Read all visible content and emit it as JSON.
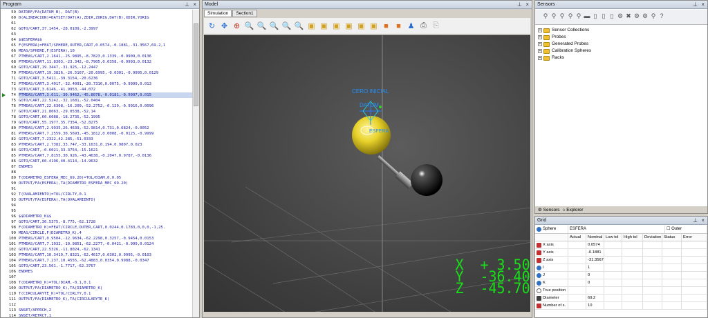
{
  "program": {
    "title": "Program",
    "lines": [
      {
        "n": "59",
        "t": "DATDEF/FA(DATUM_B), DAT(B)"
      },
      {
        "n": "60",
        "t": "D(ALINEACION)=DATSET/DAT(A),ZDIR,ZORIG,DAT(B),XDIR,YORIG"
      },
      {
        "n": "61",
        "t": ""
      },
      {
        "n": "62",
        "t": "GOTO/CART,37.1454,-28.0109,-2.3997"
      },
      {
        "n": "63",
        "t": ""
      },
      {
        "n": "64",
        "t": "$$ESFERA$$"
      },
      {
        "n": "65",
        "t": "F(ESFERA)=FEAT/SPHERE,OUTER,CART,0.0574,-0.1881,-31.3567,69.2,1"
      },
      {
        "n": "66",
        "t": "MEAS/SPHERE,F(ESFERA),10"
      },
      {
        "n": "67",
        "t": "PTMEAS/CART,2.1641,-25.9895,-8.7823,0.1339,-0.9909,0.0136"
      },
      {
        "n": "68",
        "t": "PTMEAS/CART,11.8303,-23.342,-8.7905,0.0358,-0.9993,0.0132"
      },
      {
        "n": "69",
        "t": "GOTO/CART,19.3447,-31.925,-12.2447"
      },
      {
        "n": "70",
        "t": "PTMEAS/CART,19.3826,-26.5167,-20.6995,-0.0301,-0.9995,0.0129"
      },
      {
        "n": "71",
        "t": "GOTO/CART,3.5411,-39.3154,-20.6236"
      },
      {
        "n": "72",
        "t": "PTMEAS/CART,3.4917,-32.4091,-20.7316,0.0075,-0.9999,0.013"
      },
      {
        "n": "73",
        "t": "GOTO/CART,3.6146,-41.9953,-44.072"
      },
      {
        "n": "74",
        "t": "PTMEAS/CART,3.611,-30.9462,-45.8078,-0.0181,-0.9997,0.015"
      },
      {
        "n": "75",
        "t": "GOTO/CART,22.5242,-32.1681,-52.0404"
      },
      {
        "n": "76",
        "t": "PTMEAS/CART,22.6308,-16.209,-52.2752,-0.129,-0.9916,0.0096"
      },
      {
        "n": "77",
        "t": "GOTO/CART,21.8063,-29.0538,-52.14"
      },
      {
        "n": "78",
        "t": "GOTO/CART,60.6088,-18.2735,-52.1995"
      },
      {
        "n": "79",
        "t": "GOTO/CART,55.1977,35.7354,-52.8275"
      },
      {
        "n": "80",
        "t": "PTMEAS/CART,2.9935,26.4639,-52.9814,0.731,0.6824,-0.0052"
      },
      {
        "n": "81",
        "t": "PTMEAS/CART,7.2559,30.5693,-45.1812,0.0008,-0.0125,-0.9999"
      },
      {
        "n": "82",
        "t": "GOTO/CART,7.2322,42.285,-51.0333"
      },
      {
        "n": "83",
        "t": "PTMEAS/CART,2.7382,33.747,-33.1631,0.194,0.9807,0.023"
      },
      {
        "n": "84",
        "t": "GOTO/CART,-0.6021,33.3754,-15.1621"
      },
      {
        "n": "85",
        "t": "PTMEAS/CART,7.8155,30.926,-43.4638,-0.2047,0.9787,-0.0136"
      },
      {
        "n": "86",
        "t": "GOTO/CART,60.4196,40.4114,-14.9632"
      },
      {
        "n": "87",
        "t": "ENDMES"
      },
      {
        "n": "88",
        "t": ""
      },
      {
        "n": "89",
        "t": "T(DIAMETRO_ESFERA_MEC_69.20)=TOL/DIAM,0,0.05"
      },
      {
        "n": "90",
        "t": "OUTPUT/FA(ESFERA),TA(DIAMETRO_ESFERA_MEC_69.20)"
      },
      {
        "n": "91",
        "t": ""
      },
      {
        "n": "92",
        "t": "T(OVALAMIENTO)=TOL/CIRLTY,0.1"
      },
      {
        "n": "93",
        "t": "OUTPUT/FA(ESFERA),TA(OVALAMIENTO)"
      },
      {
        "n": "94",
        "t": ""
      },
      {
        "n": "95",
        "t": ""
      },
      {
        "n": "96",
        "t": "$$DIAMETRO_K$$"
      },
      {
        "n": "97",
        "t": "GOTO/CART,36.5375,-8.775,-62.1728"
      },
      {
        "n": "98",
        "t": "F(DIAMETRO_K)=FEAT/CIRCLE,OUTER,CART,0.0244,0.1783,0,0,0,-1,25."
      },
      {
        "n": "99",
        "t": "MEAS/CIRCLE,F(DIAMETRO_K),4"
      },
      {
        "n": "100",
        "t": "PTMEAS/CART,0.9504,-12.9634,-62.2298,0.3257,-0.9454,0.0153"
      },
      {
        "n": "101",
        "t": "PTMEAS/CART,7.1932,-10.9851,-62.2277,-0.0421,-0.999,0.0124"
      },
      {
        "n": "102",
        "t": "GOTO/CART,22.5326,-11.8024,-62.1341"
      },
      {
        "n": "103",
        "t": "PTMEAS/CART,10.3419,7.8321,-62.4617,0.0302,0.9995,-0.0103"
      },
      {
        "n": "104",
        "t": "PTMEAS/CART,7.237,10.4555,-62.4883,0.0354,0.9988,-0.0347"
      },
      {
        "n": "105",
        "t": "GOTO/CART,23.561,-1.7717,-62.3767"
      },
      {
        "n": "106",
        "t": "ENDMES"
      },
      {
        "n": "107",
        "t": ""
      },
      {
        "n": "108",
        "t": "T(DIAMETRO_K)=TOL/DIAM,-0.1,0.1"
      },
      {
        "n": "109",
        "t": "OUTPUT/FA(DIAMETRO_K),TA(DIAMETRO_K)"
      },
      {
        "n": "110",
        "t": "T(CIRCULARYTE_K)=TOL/CIRLTY,0.1"
      },
      {
        "n": "111",
        "t": "OUTPUT/FA(DIAMETRO_K),TA(CIRCULARYTE_K)"
      },
      {
        "n": "112",
        "t": ""
      },
      {
        "n": "113",
        "t": "SNSET/APPRCH,2"
      },
      {
        "n": "114",
        "t": "SNSET/RETRCT,1"
      },
      {
        "n": "115",
        "t": "SNSET/SEARCH,0.5"
      },
      {
        "n": "116",
        "t": "SNSET/CLRSRF,1"
      }
    ],
    "current_line": "74"
  },
  "model": {
    "title": "Model",
    "tabs": [
      "Simulation",
      "Section1"
    ],
    "label_cero": "CERO INICIAL",
    "label_datum": "DATUM",
    "label_esfera": "ESFERA",
    "readout": {
      "x": "X  + 3.5085",
      "y": "Y  -36.4066",
      "z": "Z  -45.7023"
    }
  },
  "sensors": {
    "title": "Sensors",
    "tree": [
      "Sensor Collections",
      "Probes",
      "Generated Probes",
      "Calibration Spheres",
      "Racks"
    ],
    "tabs": [
      "Sensors",
      "Explorer"
    ]
  },
  "grid": {
    "title": "Grid",
    "feature_label": "Sphere",
    "feature_name": "ESFERA",
    "feature_type": "Outer",
    "headers": [
      "Actual",
      "Nominal",
      "Low tol",
      "High tol",
      "Deviation",
      "Status",
      "Error"
    ],
    "rows": [
      {
        "label": "X axis",
        "icon": "axis",
        "nominal": "0.0574"
      },
      {
        "label": "Y axis",
        "icon": "axis",
        "nominal": "-0.1881"
      },
      {
        "label": "Z axis",
        "icon": "axis",
        "nominal": "-31.3567"
      },
      {
        "label": "I",
        "icon": "ball",
        "nominal": "1"
      },
      {
        "label": "J",
        "icon": "ball",
        "nominal": "0"
      },
      {
        "label": "K",
        "icon": "ball",
        "nominal": "0"
      },
      {
        "label": "True position",
        "icon": "ring",
        "nominal": ""
      },
      {
        "label": "Diameter",
        "icon": "circ",
        "nominal": "69.2"
      },
      {
        "label": "Number of s.",
        "icon": "axis",
        "nominal": "10"
      }
    ]
  }
}
